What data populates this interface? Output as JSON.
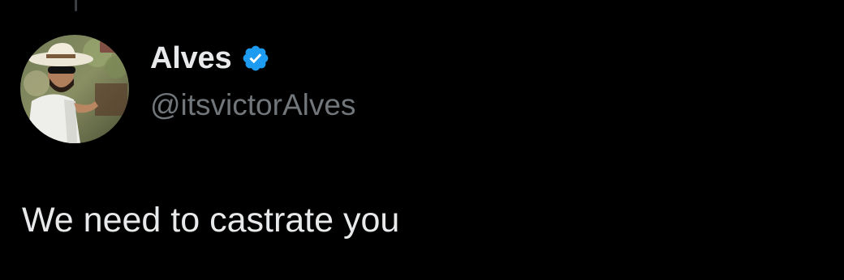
{
  "tweet": {
    "author": {
      "display_name": "Alves",
      "handle": "@itsvictorAlves",
      "verified": true,
      "avatar_icon": "profile-photo-avatar"
    },
    "text": "We need to castrate you"
  },
  "colors": {
    "background": "#000000",
    "primary_text": "#e7e9ea",
    "secondary_text": "#71767b",
    "verified_blue": "#1d9bf0"
  }
}
